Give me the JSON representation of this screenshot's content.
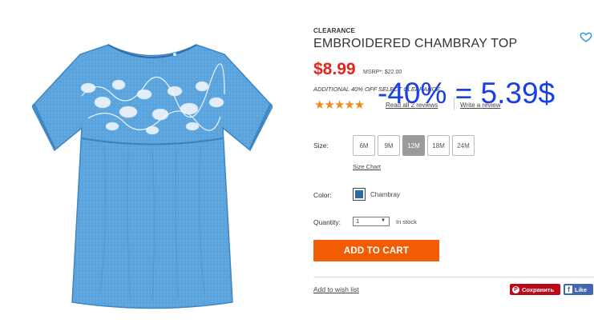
{
  "product": {
    "badge": "CLEARANCE",
    "title": "EMBROIDERED CHAMBRAY TOP",
    "price": "$8.99",
    "msrp": "MSRP*: $22.00",
    "offer": "ADDITIONAL 40% OFF SELECT CLEARANCE",
    "rating_stars": "★★★★★",
    "reviews_link": "Read all 2 reviews",
    "write_review_link": "Write a review",
    "overlay_annotation": "-40% = 5.39$"
  },
  "size": {
    "label": "Size:",
    "options": [
      "6M",
      "9M",
      "12M",
      "18M",
      "24M"
    ],
    "selected": "12M",
    "chart_link": "Size Chart"
  },
  "color": {
    "label": "Color:",
    "selected": "Chambray",
    "swatch_hex": "#2c6aa3"
  },
  "quantity": {
    "label": "Quantity:",
    "value": "1",
    "stock": "In stock"
  },
  "actions": {
    "add_to_cart": "ADD TO CART",
    "wishlist": "Add to wish list",
    "pinterest": "Сохранить",
    "facebook": "Like"
  },
  "colors": {
    "price": "#e0261b",
    "cta": "#f25c05",
    "overlay_text": "#1740e8",
    "pinterest": "#bd081c",
    "facebook": "#4267b2"
  },
  "icons": {
    "wishlist": "heart-outline-icon",
    "pinterest": "pinterest-icon",
    "facebook": "facebook-icon"
  }
}
